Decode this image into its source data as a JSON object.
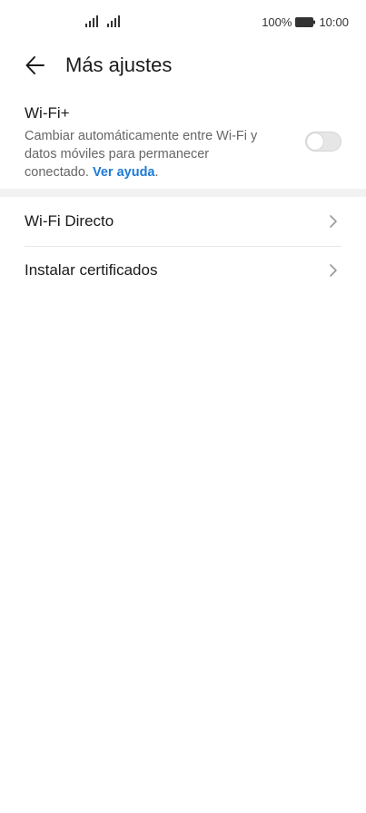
{
  "status_bar": {
    "battery_percent": "100%",
    "time": "10:00",
    "signal_icons": [
      "signal-icon",
      "signal-icon"
    ],
    "battery_icon": "battery-icon"
  },
  "app_bar": {
    "back_icon": "arrow-left-icon",
    "title": "Más ajustes"
  },
  "wifi_plus": {
    "title": "Wi-Fi+",
    "description": "Cambiar automáticamente entre Wi-Fi y datos móviles para permanecer conectado.",
    "help_link": "Ver ayuda",
    "trailing_period": ".",
    "toggle_on": false
  },
  "list": {
    "items": [
      {
        "label": "Wi-Fi Directo",
        "icon": "chevron-right-icon"
      },
      {
        "label": "Instalar certificados",
        "icon": "chevron-right-icon"
      }
    ]
  },
  "colors": {
    "accent": "#1e7ad6",
    "text_primary": "#1a1a1a",
    "text_secondary": "#666666",
    "divider": "#f2f2f2",
    "toggle_off": "#e6e6e6"
  }
}
